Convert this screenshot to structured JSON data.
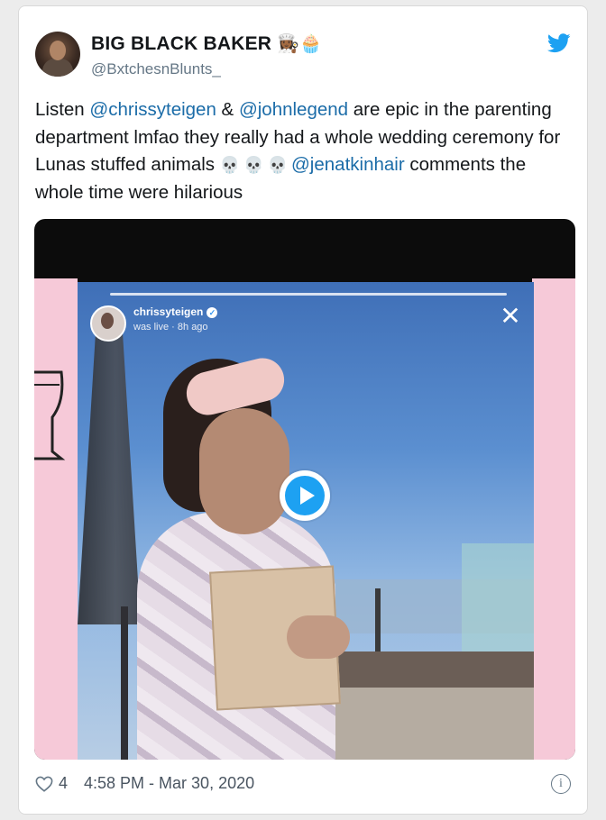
{
  "tweet": {
    "display_name": "BIG BLACK BAKER",
    "name_emojis": "👩🏾‍🍳🧁",
    "handle": "@BxtchesnBlunts_",
    "text": {
      "part1": "Listen ",
      "mention1": "@chrissyteigen",
      "part2": " & ",
      "mention2": "@johnlegend",
      "part3": " are epic in the parenting department lmfao they really had a whole wedding ceremony for Lunas stuffed animals ",
      "skulls": "💀💀💀",
      "mention3": "@jenatkinhair",
      "part4": " comments the whole time were hilarious"
    },
    "likes": "4",
    "timestamp": "4:58 PM - Mar 30, 2020"
  },
  "video": {
    "ig_user": "chrissyteigen",
    "ig_status": "was live · 8h ago",
    "close_glyph": "✕"
  },
  "icons": {
    "bird": "twitter-bird-icon",
    "heart": "heart-outline-icon",
    "play": "play-icon",
    "info": "info-icon"
  },
  "colors": {
    "twitter_blue": "#1da1f2",
    "mention_blue": "#1b6ca8",
    "pink_frame": "#f6c9d8"
  }
}
